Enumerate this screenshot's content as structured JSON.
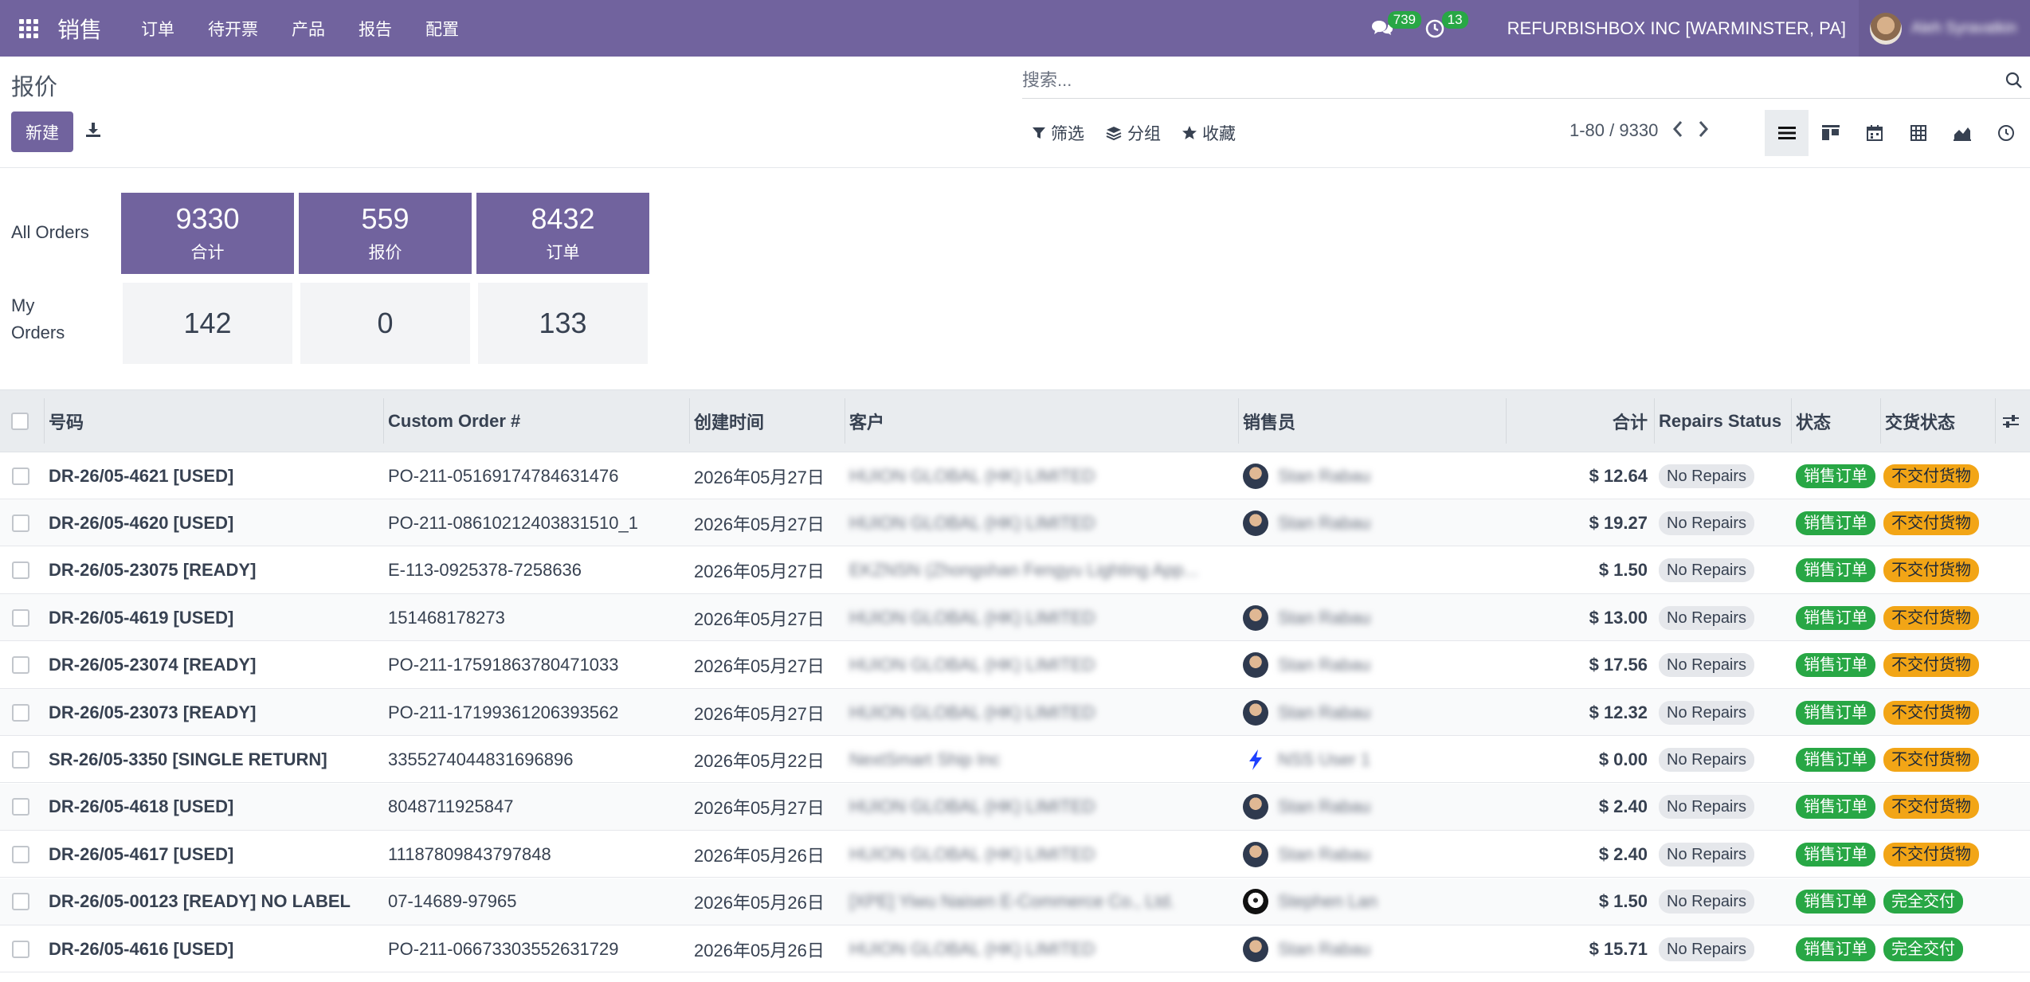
{
  "nav": {
    "brand": "销售",
    "menu": [
      "订单",
      "待开票",
      "产品",
      "报告",
      "配置"
    ],
    "messages_count": "739",
    "activities_count": "13",
    "company": "REFURBISHBOX INC [WARMINSTER, PA]",
    "user_name": "Aleh Syravatkin"
  },
  "control_panel": {
    "title": "报价",
    "new_label": "新建",
    "search_placeholder": "搜索...",
    "filter_label": "筛选",
    "group_label": "分组",
    "favorites_label": "收藏",
    "pager_text": "1-80 / 9330"
  },
  "dashboard": {
    "all_orders_label": "All Orders",
    "my_orders_label": "My Orders",
    "all_orders": [
      {
        "value": "9330",
        "label": "合计"
      },
      {
        "value": "559",
        "label": "报价"
      },
      {
        "value": "8432",
        "label": "订单"
      }
    ],
    "my_orders": [
      "142",
      "0",
      "133"
    ]
  },
  "table": {
    "columns": {
      "number": "号码",
      "custom_order": "Custom Order #",
      "created": "创建时间",
      "customer": "客户",
      "salesperson": "销售员",
      "total": "合计",
      "repairs": "Repairs Status",
      "state": "状态",
      "delivery": "交货状态"
    },
    "rows": [
      {
        "number": "DR-26/05-4621 [USED]",
        "custom_order": "PO-211-05169174784631476",
        "created": "2026年05月27日",
        "customer": "HUION GLOBAL (HK) LIMITED",
        "salesperson": "Stan Rabau",
        "total": "$ 12.64",
        "repairs": "No Repairs",
        "state": "销售订单",
        "delivery": "不交付货物"
      },
      {
        "number": "DR-26/05-4620 [USED]",
        "custom_order": "PO-211-08610212403831510_1",
        "created": "2026年05月27日",
        "customer": "HUION GLOBAL (HK) LIMITED",
        "salesperson": "Stan Rabau",
        "total": "$ 19.27",
        "repairs": "No Repairs",
        "state": "销售订单",
        "delivery": "不交付货物"
      },
      {
        "number": "DR-26/05-23075 [READY]",
        "custom_order": "E-113-0925378-7258636",
        "created": "2026年05月27日",
        "customer": "EKZNSN (Zhongshan Fengyu Lighting App...",
        "salesperson": "",
        "total": "$ 1.50",
        "repairs": "No Repairs",
        "state": "销售订单",
        "delivery": "不交付货物"
      },
      {
        "number": "DR-26/05-4619 [USED]",
        "custom_order": "151468178273",
        "created": "2026年05月27日",
        "customer": "HUION GLOBAL (HK) LIMITED",
        "salesperson": "Stan Rabau",
        "total": "$ 13.00",
        "repairs": "No Repairs",
        "state": "销售订单",
        "delivery": "不交付货物"
      },
      {
        "number": "DR-26/05-23074 [READY]",
        "custom_order": "PO-211-17591863780471033",
        "created": "2026年05月27日",
        "customer": "HUION GLOBAL (HK) LIMITED",
        "salesperson": "Stan Rabau",
        "total": "$ 17.56",
        "repairs": "No Repairs",
        "state": "销售订单",
        "delivery": "不交付货物"
      },
      {
        "number": "DR-26/05-23073 [READY]",
        "custom_order": "PO-211-17199361206393562",
        "created": "2026年05月27日",
        "customer": "HUION GLOBAL (HK) LIMITED",
        "salesperson": "Stan Rabau",
        "total": "$ 12.32",
        "repairs": "No Repairs",
        "state": "销售订单",
        "delivery": "不交付货物"
      },
      {
        "number": "SR-26/05-3350 [SINGLE RETURN]",
        "custom_order": "3355274044831696896",
        "created": "2026年05月22日",
        "customer": "NextSmart Ship Inc",
        "salesperson": "NSS User 1",
        "total": "$ 0.00",
        "repairs": "No Repairs",
        "state": "销售订单",
        "delivery": "不交付货物"
      },
      {
        "number": "DR-26/05-4618 [USED]",
        "custom_order": "8048711925847",
        "created": "2026年05月27日",
        "customer": "HUION GLOBAL (HK) LIMITED",
        "salesperson": "Stan Rabau",
        "total": "$ 2.40",
        "repairs": "No Repairs",
        "state": "销售订单",
        "delivery": "不交付货物"
      },
      {
        "number": "DR-26/05-4617 [USED]",
        "custom_order": "11187809843797848",
        "created": "2026年05月26日",
        "customer": "HUION GLOBAL (HK) LIMITED",
        "salesperson": "Stan Rabau",
        "total": "$ 2.40",
        "repairs": "No Repairs",
        "state": "销售订单",
        "delivery": "不交付货物"
      },
      {
        "number": "DR-26/05-00123 [READY] NO LABEL",
        "custom_order": "07-14689-97965",
        "created": "2026年05月26日",
        "customer": "[XPE] Yiwu Naisen E-Commerce Co., Ltd.",
        "salesperson": "Stephen Lan",
        "total": "$ 1.50",
        "repairs": "No Repairs",
        "state": "销售订单",
        "delivery": "完全交付"
      },
      {
        "number": "DR-26/05-4616 [USED]",
        "custom_order": "PO-211-06673303552631729",
        "created": "2026年05月26日",
        "customer": "HUION GLOBAL (HK) LIMITED",
        "salesperson": "Stan Rabau",
        "total": "$ 15.71",
        "repairs": "No Repairs",
        "state": "销售订单",
        "delivery": "完全交付"
      }
    ]
  },
  "colors": {
    "brand": "#71639e",
    "success": "#28a745",
    "warning": "#f2a516"
  }
}
